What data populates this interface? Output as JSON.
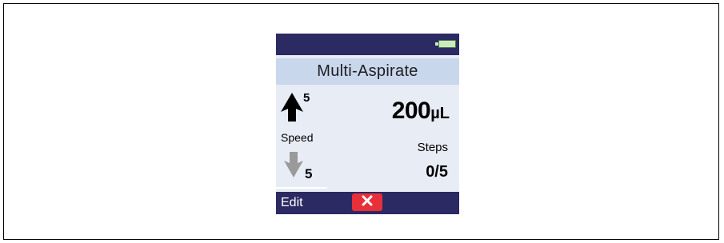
{
  "device": {
    "battery_icon": "battery-full-icon",
    "mode_title": "Multi-Aspirate",
    "speed": {
      "up_value": "5",
      "label": "Speed",
      "down_value": "5",
      "up_icon": "speed-up-arrow-icon",
      "down_icon": "speed-down-arrow-icon"
    },
    "volume": {
      "value": "200",
      "unit": "µL"
    },
    "steps": {
      "label": "Steps",
      "value": "0/5"
    },
    "softkeys": {
      "left_label": "Edit",
      "cancel_icon": "close-icon"
    }
  },
  "colors": {
    "header_bar": "#2b2a63",
    "title_bar": "#c9d7ed",
    "screen_bg": "#e8ecf5",
    "cancel_button": "#e8303a",
    "battery": "#cfe6c4"
  }
}
